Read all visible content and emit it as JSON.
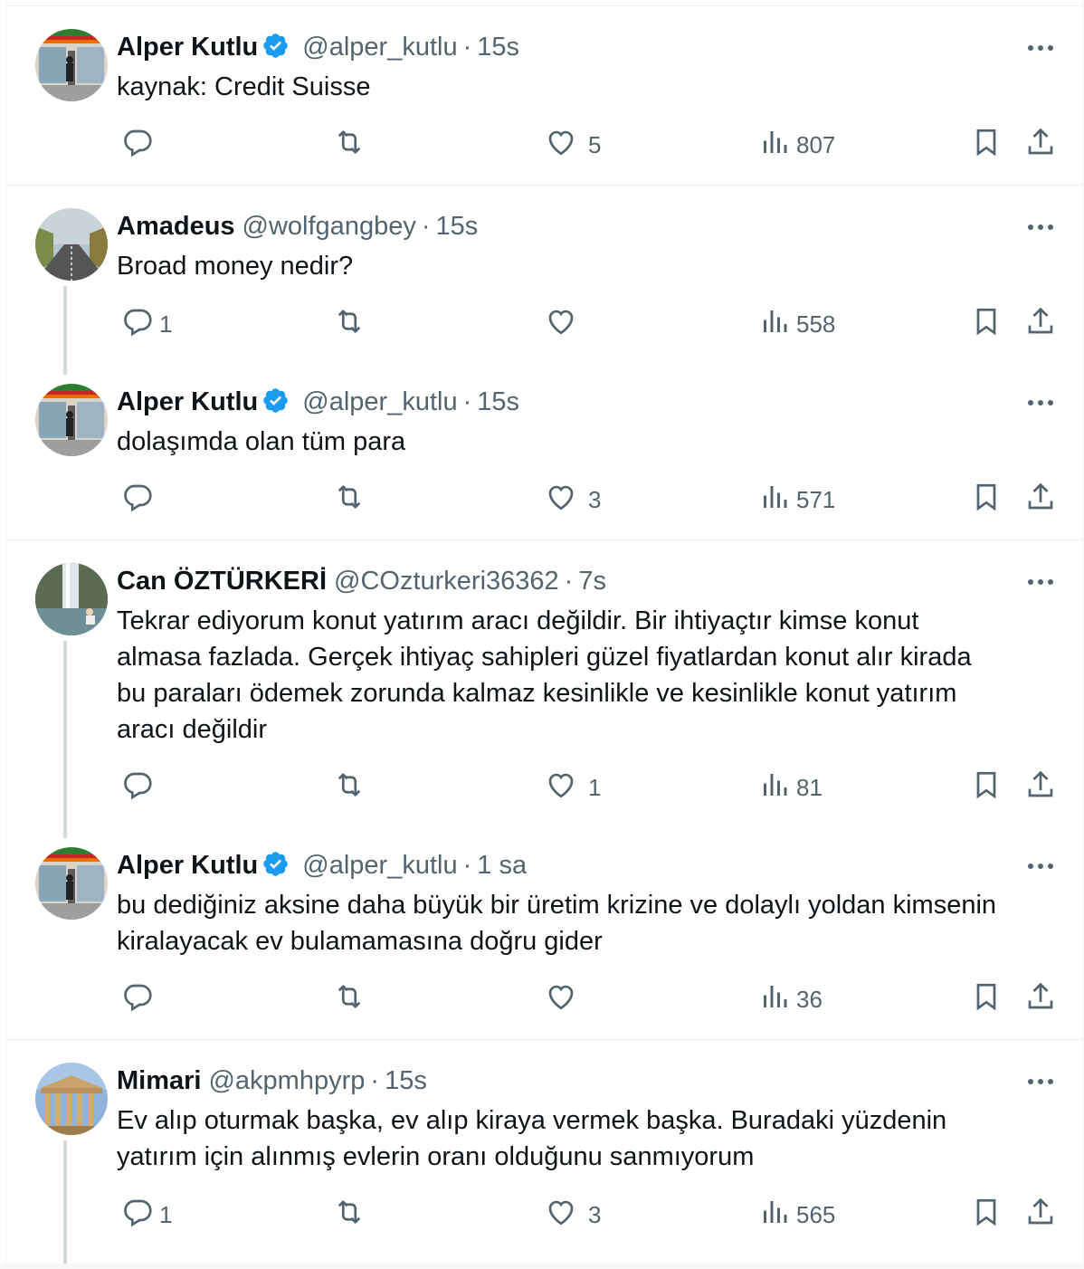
{
  "tweets": [
    {
      "name": "Alper Kutlu",
      "verified": true,
      "handle": "@alper_kutlu",
      "time": "15s",
      "text": "kaynak: Credit Suisse",
      "replies": "",
      "likes": "5",
      "views": "807",
      "avatar": "storefront"
    },
    {
      "name": "Amadeus",
      "verified": false,
      "handle": "@wolfgangbey",
      "time": "15s",
      "text": "Broad money nedir?",
      "replies": "1",
      "likes": "",
      "views": "558",
      "avatar": "road"
    },
    {
      "name": "Alper Kutlu",
      "verified": true,
      "handle": "@alper_kutlu",
      "time": "15s",
      "text": "dolaşımda olan tüm para",
      "replies": "",
      "likes": "3",
      "views": "571",
      "avatar": "storefront"
    },
    {
      "name": "Can ÖZTÜRKERİ",
      "verified": false,
      "handle": "@COzturkeri36362",
      "time": "7s",
      "text_lines": [
        "Tekrar ediyorum konut yatırım aracı değildir. Bir ihtiyaçtır kimse konut",
        "almasa fazlada. Gerçek ihtiyaç sahipleri güzel fiyatlardan konut alır kirada",
        "bu paraları ödemek zorunda kalmaz kesinlikle ve kesinlikle konut yatırım",
        "aracı değildir"
      ],
      "replies": "",
      "likes": "1",
      "views": "81",
      "avatar": "waterfall"
    },
    {
      "name": "Alper Kutlu",
      "verified": true,
      "handle": "@alper_kutlu",
      "time": "1 sa",
      "text_lines": [
        "bu dediğiniz aksine daha büyük bir üretim krizine ve dolaylı yoldan kimsenin",
        "kiralayacak ev bulamamasına doğru gider"
      ],
      "replies": "",
      "likes": "",
      "views": "36",
      "avatar": "storefront"
    },
    {
      "name": "Mimari",
      "verified": false,
      "handle": "@akpmhpyrp",
      "time": "15s",
      "text_lines": [
        "Ev alıp oturmak başka, ev alıp kiraya vermek başka. Buradaki yüzdenin",
        "yatırım için alınmış evlerin oranı olduğunu sanmıyorum"
      ],
      "replies": "1",
      "likes": "3",
      "views": "565",
      "avatar": "temple"
    }
  ],
  "icons": {
    "reply": "reply-icon",
    "retweet": "retweet-icon",
    "like": "like-icon",
    "views": "views-icon",
    "bookmark": "bookmark-icon",
    "share": "share-icon",
    "more": "more-icon",
    "verified": "verified-badge-icon"
  },
  "colors": {
    "text": "#0f1419",
    "secondary": "#536471",
    "verified": "#1d9bf0",
    "thread_line": "#cfd9de",
    "separator": "#eff3f4"
  }
}
